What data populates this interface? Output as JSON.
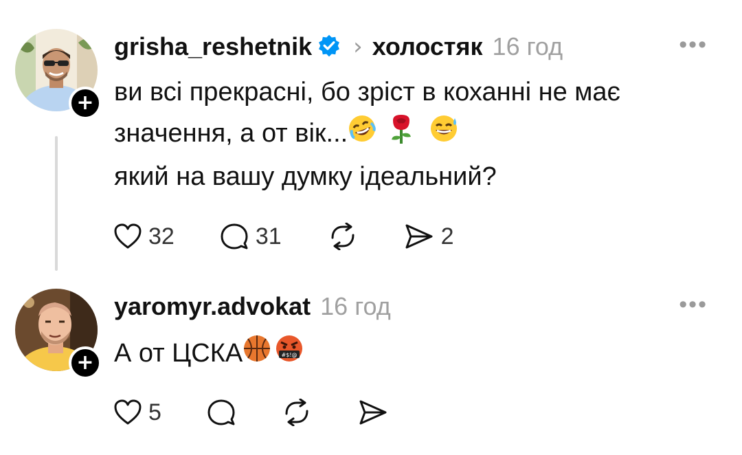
{
  "posts": [
    {
      "username": "grisha_reshetnik",
      "verified": true,
      "community": "холостяк",
      "time": "16 год",
      "text_lines": [
        "ви всі прекрасні, бо зріст в коханні не має",
        "значення, а от вік...",
        "який на вашу думку ідеальний?"
      ],
      "emojis": [
        "rolling-laughing-emoji",
        "rose-emoji",
        "sweat-smile-emoji"
      ],
      "likes": "32",
      "replies": "31",
      "shares": "2"
    },
    {
      "username": "yaromyr.advokat",
      "time": "16 год",
      "text": "А от ЦСКА",
      "emojis": [
        "basketball-emoji",
        "cursing-face-emoji"
      ],
      "likes": "5"
    }
  ],
  "icons": {
    "more": "more-horizontal-icon",
    "like": "heart-icon",
    "reply": "comment-icon",
    "repost": "repost-icon",
    "share": "send-icon",
    "follow": "plus-icon",
    "verified": "verified-badge-icon"
  },
  "colors": {
    "text": "#111111",
    "muted": "#a0a0a0",
    "verified": "#0095f6",
    "thread_line": "#d9d9d9"
  }
}
